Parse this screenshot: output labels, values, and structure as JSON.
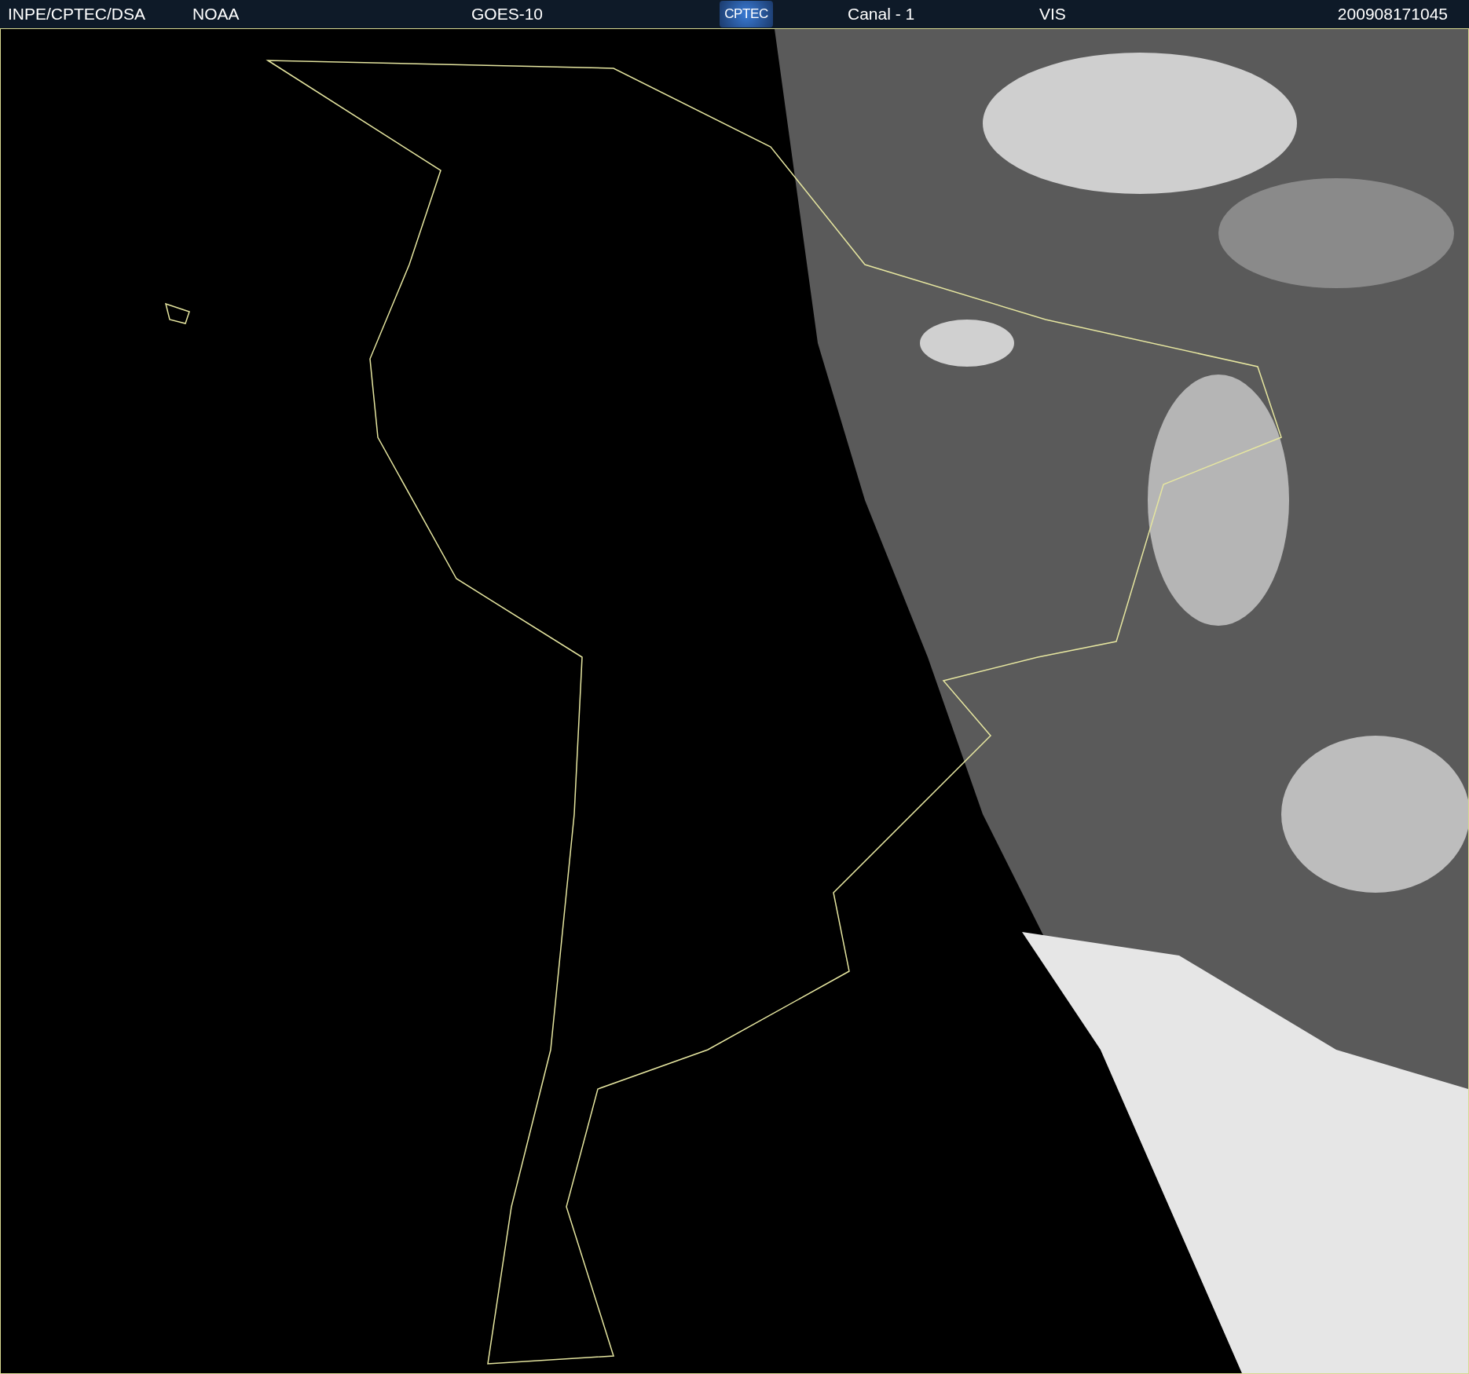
{
  "header": {
    "source": "INPE/CPTEC/DSA",
    "agency": "NOAA",
    "satellite": "GOES-10",
    "logo": "CPTEC",
    "channel": "Canal - 1",
    "band": "VIS",
    "timestamp": "200908171045"
  }
}
